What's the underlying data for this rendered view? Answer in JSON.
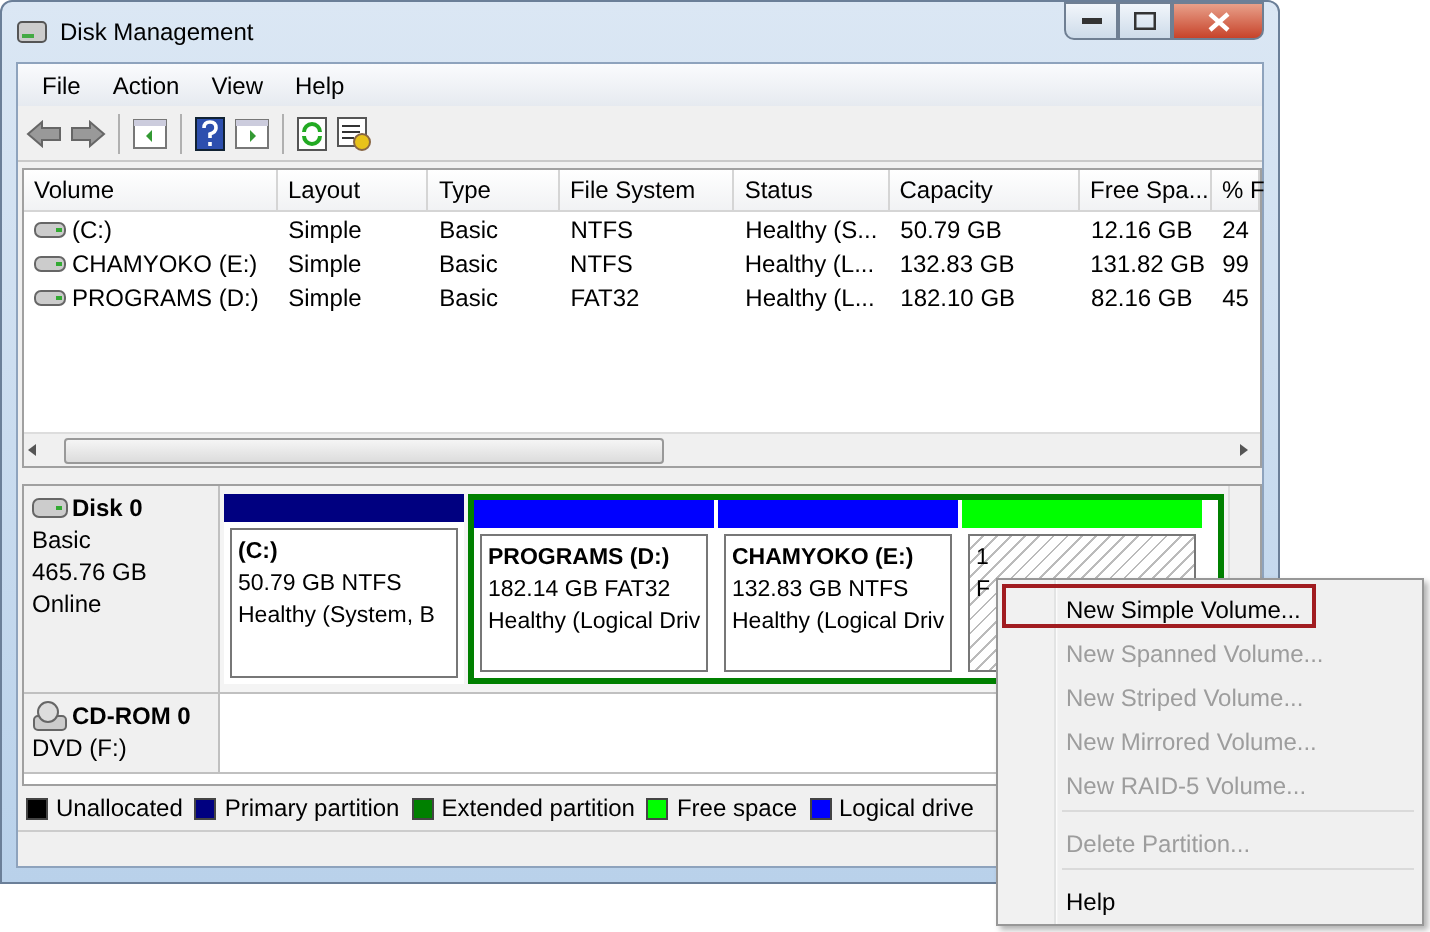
{
  "window": {
    "title": "Disk Management"
  },
  "menu_bar": [
    "File",
    "Action",
    "View",
    "Help"
  ],
  "table": {
    "columns": [
      "Volume",
      "Layout",
      "Type",
      "File System",
      "Status",
      "Capacity",
      "Free Spa...",
      "% F"
    ],
    "rows": [
      [
        "(C:)",
        "Simple",
        "Basic",
        "NTFS",
        "Healthy (S...",
        "50.79 GB",
        "12.16 GB",
        "24"
      ],
      [
        "CHAMYOKO (E:)",
        "Simple",
        "Basic",
        "NTFS",
        "Healthy (L...",
        "132.83 GB",
        "131.82 GB",
        "99"
      ],
      [
        "PROGRAMS (D:)",
        "Simple",
        "Basic",
        "FAT32",
        "Healthy (L...",
        "182.10 GB",
        "82.16 GB",
        "45"
      ]
    ]
  },
  "disks": [
    {
      "kind": "disk",
      "name": "Disk 0",
      "lines": [
        "Basic",
        "465.76 GB",
        "Online"
      ],
      "partitions": [
        {
          "kind": "primary",
          "title": "(C:)",
          "lines": [
            "50.79 GB NTFS",
            "Healthy (System, B"
          ]
        },
        {
          "kind": "extended",
          "children": [
            {
              "kind": "logical",
              "title": "PROGRAMS  (D:)",
              "lines": [
                "182.14 GB FAT32",
                "Healthy (Logical Driv"
              ]
            },
            {
              "kind": "logical",
              "title": "CHAMYOKO  (E:)",
              "lines": [
                "132.83 GB NTFS",
                "Healthy (Logical Driv"
              ]
            },
            {
              "kind": "free",
              "lines": [
                "1",
                "F"
              ]
            }
          ]
        }
      ]
    },
    {
      "kind": "cdrom",
      "name": "CD-ROM 0",
      "lines": [
        "DVD (F:)"
      ]
    }
  ],
  "legend": [
    {
      "label": "Unallocated",
      "color": "#000000"
    },
    {
      "label": "Primary partition",
      "color": "#000080"
    },
    {
      "label": "Extended partition",
      "color": "#008000"
    },
    {
      "label": "Free space",
      "color": "#00ff00"
    },
    {
      "label": "Logical drive",
      "color": "#0000ff"
    }
  ],
  "context_menu": [
    {
      "label": "New Simple Volume...",
      "disabled": false,
      "selected": true
    },
    {
      "label": "New Spanned Volume...",
      "disabled": true,
      "selected": false
    },
    {
      "label": "New Striped Volume...",
      "disabled": true,
      "selected": false
    },
    {
      "label": "New Mirrored Volume...",
      "disabled": true,
      "selected": false
    },
    {
      "label": "New RAID-5 Volume...",
      "disabled": true,
      "selected": false
    },
    {
      "kind": "separator"
    },
    {
      "label": "Delete Partition...",
      "disabled": true,
      "selected": false
    },
    {
      "kind": "separator"
    },
    {
      "label": "Help",
      "disabled": false,
      "selected": false
    }
  ]
}
